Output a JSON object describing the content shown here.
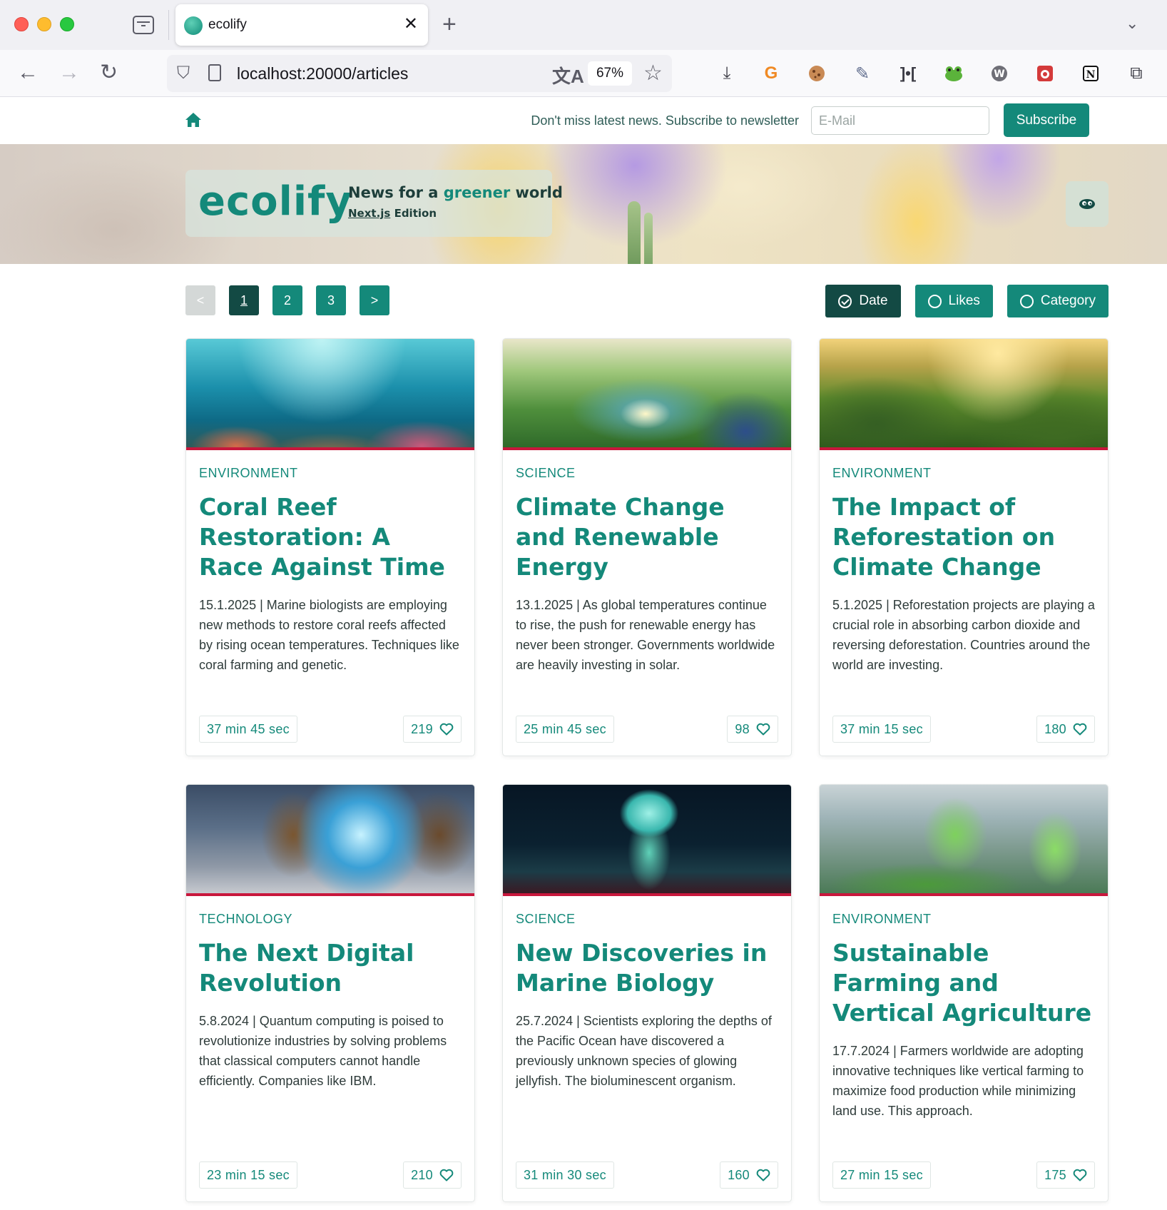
{
  "browser": {
    "tab_title": "ecolify",
    "url": "localhost:20000/articles",
    "zoom": "67%"
  },
  "header": {
    "newsletter_text": "Don't miss latest news. Subscribe to newsletter",
    "email_placeholder": "E-Mail",
    "subscribe_label": "Subscribe"
  },
  "hero": {
    "logo": "ecolify",
    "tagline_before": "News for a",
    "tagline_accent": "greener",
    "tagline_after": "world",
    "edition_link": "Next.js",
    "edition_suffix": "Edition"
  },
  "pagination": {
    "prev": "<",
    "pages": [
      "1",
      "2",
      "3"
    ],
    "next": ">",
    "current": "1"
  },
  "sort": {
    "date": "Date",
    "likes": "Likes",
    "category": "Category",
    "active": "Date"
  },
  "articles": [
    {
      "category": "ENVIRONMENT",
      "title": "Coral Reef Restoration: A Race Against Time",
      "summary": "15.1.2025 | Marine biologists are employing new methods to restore coral reefs affected by rising ocean temperatures. Techniques like coral farming and genetic.",
      "read_time": "37 min 45 sec",
      "likes": "219"
    },
    {
      "category": "SCIENCE",
      "title": "Climate Change and Renewable Energy",
      "summary": "13.1.2025 | As global temperatures continue to rise, the push for renewable energy has never been stronger. Governments worldwide are heavily investing in solar.",
      "read_time": "25 min 45 sec",
      "likes": "98"
    },
    {
      "category": "ENVIRONMENT",
      "title": "The Impact of Reforestation on Climate Change",
      "summary": "5.1.2025 | Reforestation projects are playing a crucial role in absorbing carbon dioxide and reversing deforestation. Countries around the world are investing.",
      "read_time": "37 min 15 sec",
      "likes": "180"
    },
    {
      "category": "TECHNOLOGY",
      "title": "The Next Digital Revolution",
      "summary": "5.8.2024 | Quantum computing is poised to revolutionize industries by solving problems that classical computers cannot handle efficiently. Companies like IBM.",
      "read_time": "23 min 15 sec",
      "likes": "210"
    },
    {
      "category": "SCIENCE",
      "title": "New Discoveries in Marine Biology",
      "summary": "25.7.2024 | Scientists exploring the depths of the Pacific Ocean have discovered a previously unknown species of glowing jellyfish. The bioluminescent organism.",
      "read_time": "31 min 30 sec",
      "likes": "160"
    },
    {
      "category": "ENVIRONMENT",
      "title": "Sustainable Farming and Vertical Agriculture",
      "summary": "17.7.2024 | Farmers worldwide are adopting innovative techniques like vertical farming to maximize food production while minimizing land use. This approach.",
      "read_time": "27 min 15 sec",
      "likes": "175"
    }
  ],
  "colors": {
    "brand": "#14897a",
    "brand_dark": "#134a44",
    "image_rule": "#c8173c"
  }
}
